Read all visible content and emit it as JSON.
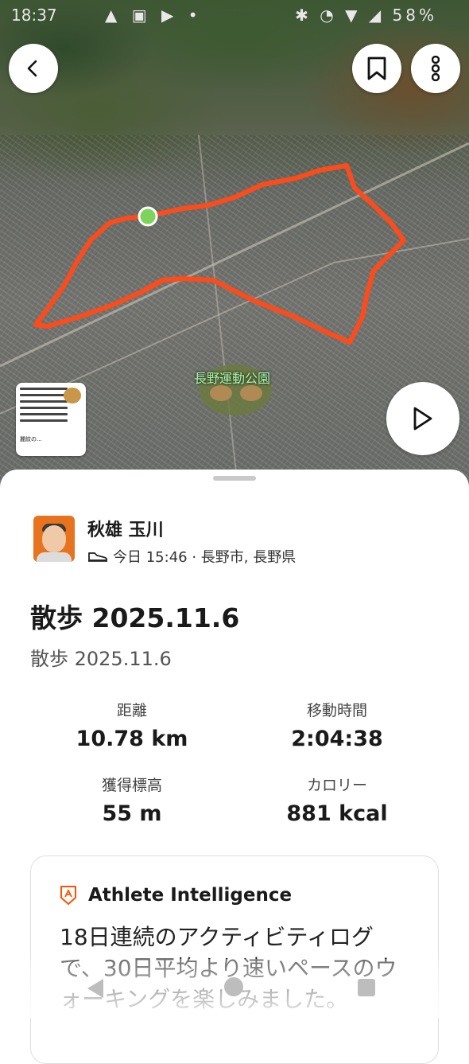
{
  "status_bar": {
    "time": "18:37",
    "icons": "▲ ▣ ▶ •",
    "right_icons": "✱ ◔ ▼ ◢",
    "battery": "58%"
  },
  "map": {
    "park_label": "長野運動公園",
    "route_color": "#ff4a1a",
    "start_marker_color": "#7ed35a",
    "thumbnail": {
      "title": "麗紋の..."
    }
  },
  "header_buttons": {
    "back_icon": "chevron-left",
    "bookmark_icon": "bookmark",
    "more_icon": "vertical-dots",
    "play_icon": "play"
  },
  "user": {
    "name": "秋雄 玉川",
    "meta": "今日 15:46 · 長野市, 長野県",
    "activity_icon": "shoe"
  },
  "activity": {
    "title": "散歩 2025.11.6",
    "subtitle": "散歩 2025.11.6"
  },
  "stats": [
    {
      "label": "距離",
      "value": "10.78 km"
    },
    {
      "label": "移動時間",
      "value": "2:04:38"
    },
    {
      "label": "獲得標高",
      "value": "55 m"
    },
    {
      "label": "カロリー",
      "value": "881 kcal"
    }
  ],
  "athlete_intelligence": {
    "title": "Athlete Intelligence",
    "body": "18日連続のアクティビティログで、30日平均より速いペースのウォーキングを楽しみました。"
  },
  "colors": {
    "accent": "#fc5200",
    "text": "#1a1a1a",
    "muted": "#555555"
  }
}
